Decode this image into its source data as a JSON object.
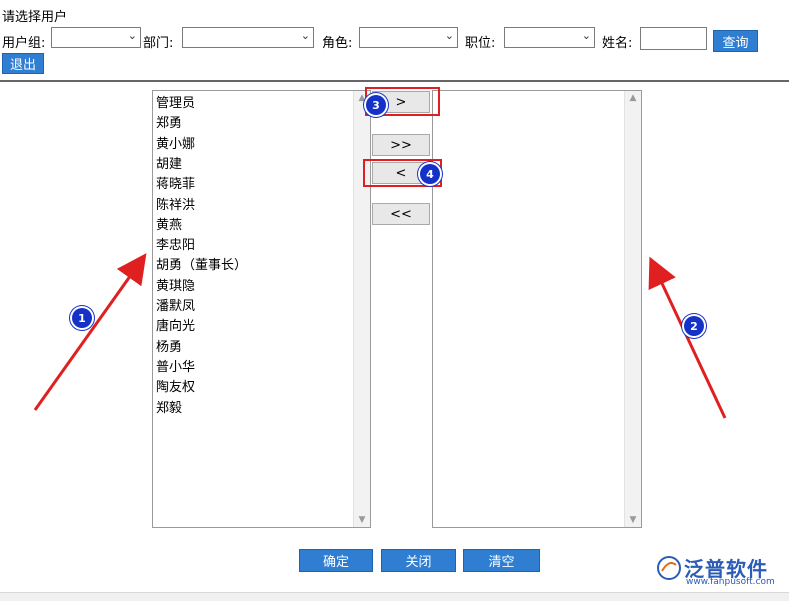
{
  "header": {
    "title": "请选择用户",
    "filters": {
      "user_group_label": "用户组:",
      "department_label": "部门:",
      "role_label": "角色:",
      "position_label": "职位:",
      "name_label": "姓名:",
      "user_group_value": "",
      "department_value": "",
      "role_value": "",
      "position_value": "",
      "name_value": ""
    },
    "query_button": "查询",
    "exit_button": "退出"
  },
  "left_list": {
    "items": [
      "管理员",
      "郑勇",
      "黄小娜",
      "胡建",
      "蒋晓菲",
      "陈祥洪",
      "黄燕",
      "李忠阳",
      "胡勇（董事长）",
      "黄琪隐",
      "潘默凤",
      "唐向光",
      "杨勇",
      "普小华",
      "陶友权",
      "郑毅"
    ]
  },
  "right_list": {
    "items": []
  },
  "transfer_buttons": {
    "add_one": ">",
    "add_all": ">>",
    "remove_one": "<",
    "remove_all": "<<"
  },
  "footer": {
    "confirm": "确定",
    "close": "关闭",
    "clear": "清空"
  },
  "annotations": {
    "badge_1": "1",
    "badge_2": "2",
    "badge_3": "3",
    "badge_4": "4"
  },
  "logo": {
    "name": "泛普软件",
    "url": "www.fanpusoft.com"
  },
  "colors": {
    "button_blue": "#2f7ed1",
    "annotation_red": "#e02020",
    "badge_blue": "#1431c8"
  }
}
